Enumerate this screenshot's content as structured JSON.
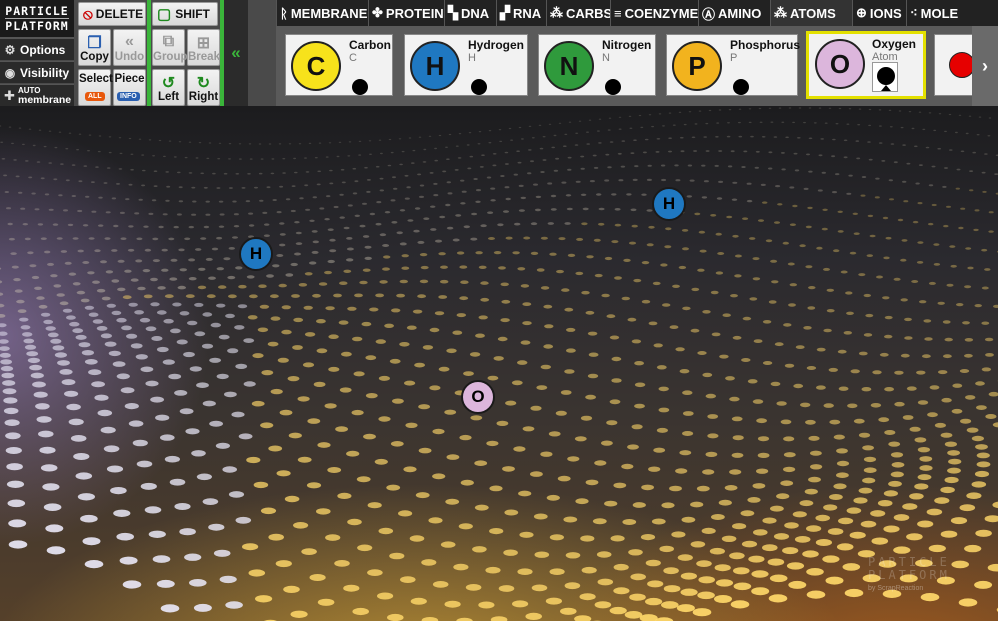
{
  "logo": {
    "line1": "PARTICLE",
    "line2": "PLATFORM"
  },
  "left_menu": {
    "options": "Options",
    "visibility": "Visibility",
    "auto_top": "AUTO",
    "auto_bottom": "membrane"
  },
  "tools": {
    "delete": "DELETE",
    "shift": "SHIFT",
    "copy": "Copy",
    "undo": "Undo",
    "group": "Group",
    "break": "Break",
    "select": "Select",
    "select_tag": "ALL",
    "piece": "Piece",
    "piece_tag": "INFO",
    "left": "Left",
    "right": "Right"
  },
  "tabs": [
    {
      "label": "MEMBRANE",
      "icon": "membrane-icon"
    },
    {
      "label": "PROTEINS",
      "icon": "protein-icon"
    },
    {
      "label": "DNA",
      "icon": "dna-icon"
    },
    {
      "label": "RNA",
      "icon": "rna-icon"
    },
    {
      "label": "CARBS",
      "icon": "carbs-icon"
    },
    {
      "label": "COENZYMES",
      "icon": "coenzyme-icon"
    },
    {
      "label": "AMINO",
      "icon": "amino-icon"
    },
    {
      "label": "ATOMS",
      "icon": "atoms-icon"
    },
    {
      "label": "IONS",
      "icon": "ions-icon"
    },
    {
      "label": "MOLE",
      "icon": "molecule-icon"
    }
  ],
  "atom_cards": [
    {
      "name": "Carbon",
      "symbol": "C",
      "sub": "C",
      "color": "#f7e21b",
      "text_color": "#111111"
    },
    {
      "name": "Hydrogen",
      "symbol": "H",
      "sub": "H",
      "color": "#1f78c1",
      "text_color": "#111111"
    },
    {
      "name": "Nitrogen",
      "symbol": "N",
      "sub": "N",
      "color": "#2f9a3c",
      "text_color": "#111111"
    },
    {
      "name": "Phosphorus",
      "symbol": "P",
      "sub": "P",
      "color": "#f2b31e",
      "text_color": "#111111"
    },
    {
      "name": "Oxygen",
      "symbol": "O",
      "sub": "Atom",
      "color": "#dcb6dc",
      "text_color": "#111111",
      "selected": true
    },
    {
      "name": "",
      "symbol": "",
      "sub": "",
      "color": "#e60000",
      "text_color": "#111111"
    }
  ],
  "canvas_atoms": [
    {
      "symbol": "H",
      "color": "#1f78c1"
    },
    {
      "symbol": "H",
      "color": "#1f78c1"
    },
    {
      "symbol": "O",
      "color": "#dcb6dc"
    }
  ],
  "watermark": {
    "line1": "PARTICLE",
    "line2": "PLATFORM",
    "credit": "by ScrapReaction"
  }
}
